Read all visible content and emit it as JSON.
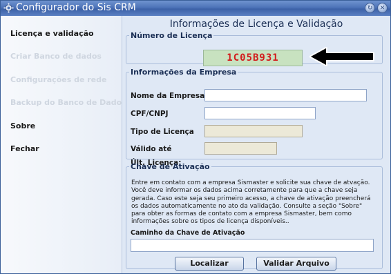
{
  "window": {
    "title": "Configurador do Sis CRM"
  },
  "sidebar": {
    "items": [
      {
        "label": "Licença e validação",
        "enabled": true
      },
      {
        "label": "Criar Banco de dados",
        "enabled": false
      },
      {
        "label": "Configurações de rede",
        "enabled": false
      },
      {
        "label": "Backup do Banco de Dados",
        "enabled": false
      },
      {
        "label": "Sobre",
        "enabled": true
      },
      {
        "label": "Fechar",
        "enabled": true
      }
    ]
  },
  "main": {
    "title": "Informações de Licença e Validação",
    "license": {
      "legend": "Número de Licença",
      "value": "1C05B931"
    },
    "company": {
      "legend": "Informações da Empresa",
      "fields": {
        "name_label": "Nome da Empresa",
        "cpf_label": "CPF/CNPJ",
        "type_label": "Tipo de Licença",
        "valid_label": "Válido até",
        "last_label": "Últ. Licença:"
      }
    },
    "activation": {
      "legend": "Chave de Ativação",
      "info": "Entre em contato com a empresa Sismaster e solicite sua chave de atvação. Você deve informar os dados acima corretamente para que a chave seja gerada. Caso este seja seu primeiro acesso, a chave de ativação preencherá os dados automaticamente no ato da validação. Consulte a seção \"Sobre\" para obter as formas de contato com a empresa Sismaster, bem como informações sobre os tipos de licença disponíveis..",
      "path_label": "Caminho da Chave de Ativação",
      "locate_button": "Localizar",
      "validate_button": "Validar Arquivo"
    }
  },
  "colors": {
    "license_text": "#d21c1c",
    "license_bg": "#c8e2c0",
    "titlebar": "#4d73b8"
  }
}
